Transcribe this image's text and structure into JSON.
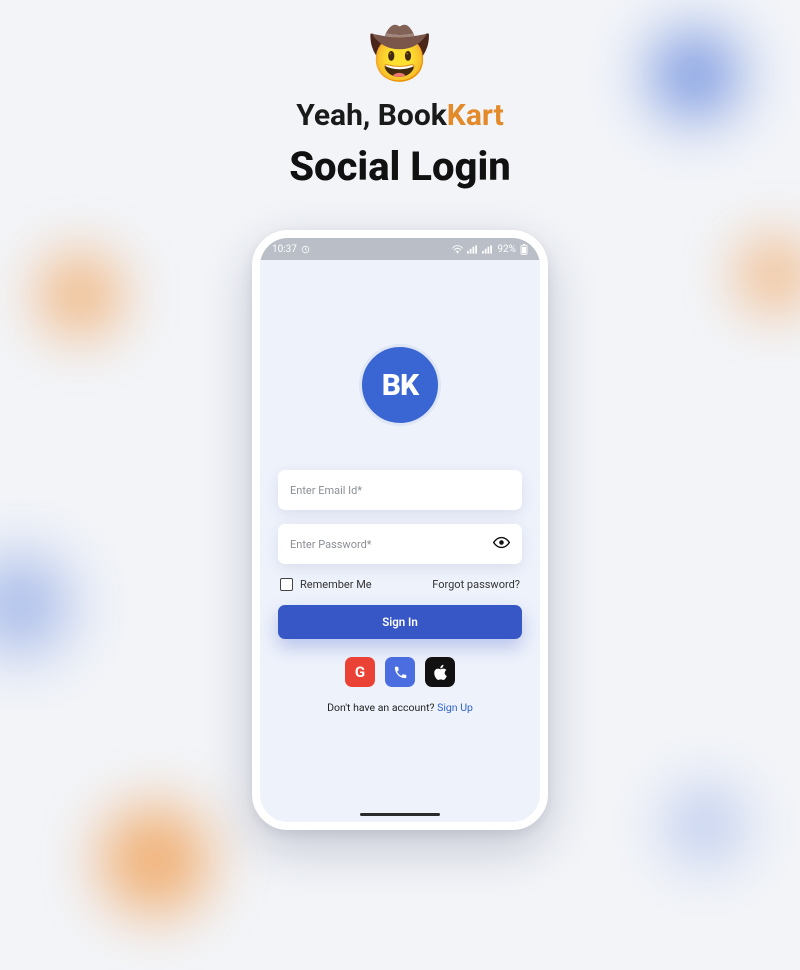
{
  "hero": {
    "emoji": "🤠",
    "line1_prefix": "Yeah, Book",
    "line1_accent": "Kart",
    "line2": "Social Login"
  },
  "statusbar": {
    "time": "10:37",
    "battery": "92%"
  },
  "logo": {
    "text": "BK"
  },
  "form": {
    "email_placeholder": "Enter Email Id*",
    "password_placeholder": "Enter Password*",
    "remember_label": "Remember Me",
    "forgot_label": "Forgot password?",
    "signin_label": "Sign In"
  },
  "social": {
    "google_glyph": "G",
    "phone_glyph": "📞",
    "apple_glyph": ""
  },
  "signup": {
    "prompt": "Don't have an account? ",
    "link": "Sign Up"
  }
}
